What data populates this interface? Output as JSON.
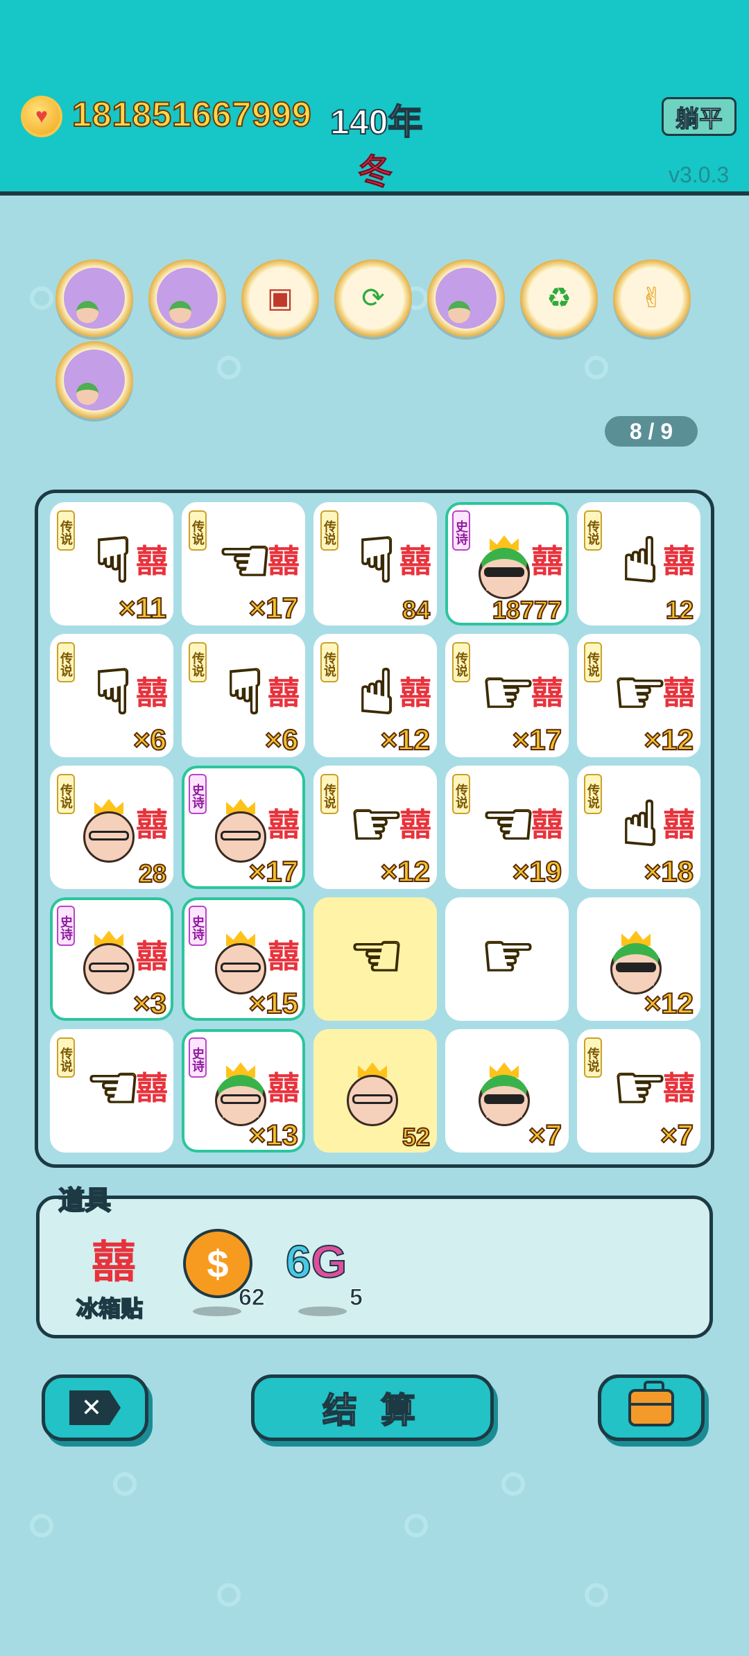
{
  "header": {
    "coins": "181851667999",
    "year": "140年",
    "season": "冬",
    "lie_flat_button": "躺平",
    "version": "v3.0.3"
  },
  "relics": [
    {
      "icon": "multiplier-face-icon"
    },
    {
      "icon": "multiplier-face-icon"
    },
    {
      "icon": "time-magazine-icon"
    },
    {
      "icon": "refresh-icon"
    },
    {
      "icon": "multiplier-face-icon"
    },
    {
      "icon": "recycle-icon"
    },
    {
      "icon": "rock-hand-icon"
    },
    {
      "icon": "multiplier-face-icon"
    }
  ],
  "counter": "8 / 9",
  "rarity": {
    "legend": "传说",
    "epic": "史诗"
  },
  "board": [
    [
      {
        "type": "hand",
        "rarity": "legend",
        "glyph": "☟",
        "value": "×11"
      },
      {
        "type": "hand",
        "rarity": "legend",
        "glyph": "☜",
        "value": "×17"
      },
      {
        "type": "hand",
        "rarity": "legend",
        "glyph": "☟",
        "value": "84"
      },
      {
        "type": "head",
        "rarity": "epic",
        "variant": "green-dark",
        "value": "18777"
      },
      {
        "type": "hand",
        "rarity": "legend",
        "glyph": "☝",
        "value": "12"
      }
    ],
    [
      {
        "type": "hand",
        "rarity": "legend",
        "glyph": "☟",
        "value": "×6"
      },
      {
        "type": "hand",
        "rarity": "legend",
        "glyph": "☟",
        "value": "×6"
      },
      {
        "type": "hand",
        "rarity": "legend",
        "glyph": "☝",
        "value": "×12"
      },
      {
        "type": "hand",
        "rarity": "legend",
        "glyph": "☞",
        "value": "×17"
      },
      {
        "type": "hand",
        "rarity": "legend",
        "glyph": "☞",
        "value": "×12"
      }
    ],
    [
      {
        "type": "head",
        "rarity": "legend",
        "variant": "gold",
        "value": "28"
      },
      {
        "type": "head",
        "rarity": "epic",
        "variant": "plain",
        "value": "×17"
      },
      {
        "type": "hand",
        "rarity": "legend",
        "glyph": "☞",
        "value": "×12"
      },
      {
        "type": "hand",
        "rarity": "legend",
        "glyph": "☜",
        "value": "×19"
      },
      {
        "type": "hand",
        "rarity": "legend",
        "glyph": "☝",
        "value": "×18"
      }
    ],
    [
      {
        "type": "head",
        "rarity": "epic",
        "variant": "plain",
        "value": "×3"
      },
      {
        "type": "head",
        "rarity": "epic",
        "variant": "plain",
        "value": "×15"
      },
      {
        "type": "hand",
        "rarity": "none",
        "glyph": "☜",
        "value": "",
        "highlight": true
      },
      {
        "type": "hand",
        "rarity": "none",
        "glyph": "☞",
        "value": ""
      },
      {
        "type": "head",
        "rarity": "none",
        "variant": "green-dark",
        "value": "×12"
      }
    ],
    [
      {
        "type": "hand",
        "rarity": "legend",
        "glyph": "☜",
        "value": ""
      },
      {
        "type": "head",
        "rarity": "epic",
        "variant": "green",
        "value": "×13"
      },
      {
        "type": "head",
        "rarity": "none",
        "variant": "plain",
        "value": "52",
        "highlight": true
      },
      {
        "type": "head",
        "rarity": "none",
        "variant": "green-dark",
        "value": "×7"
      },
      {
        "type": "hand",
        "rarity": "legend",
        "glyph": "☞",
        "value": "×7"
      }
    ]
  ],
  "items_panel": {
    "title": "道具",
    "fridge_label": "冰箱贴",
    "fridge_glyph": "囍",
    "dollar_count": "62",
    "g6_six": "6",
    "g6_g": "G",
    "g6_count": "5"
  },
  "buttons": {
    "settle": "结 算",
    "close_glyph": "✕"
  },
  "colors": {
    "header_bg": "#17c6c6",
    "page_bg": "#a6dbe4",
    "accent_red": "#e8323c",
    "coin_gold": "#ffd64a",
    "outline": "#1d3a44"
  }
}
